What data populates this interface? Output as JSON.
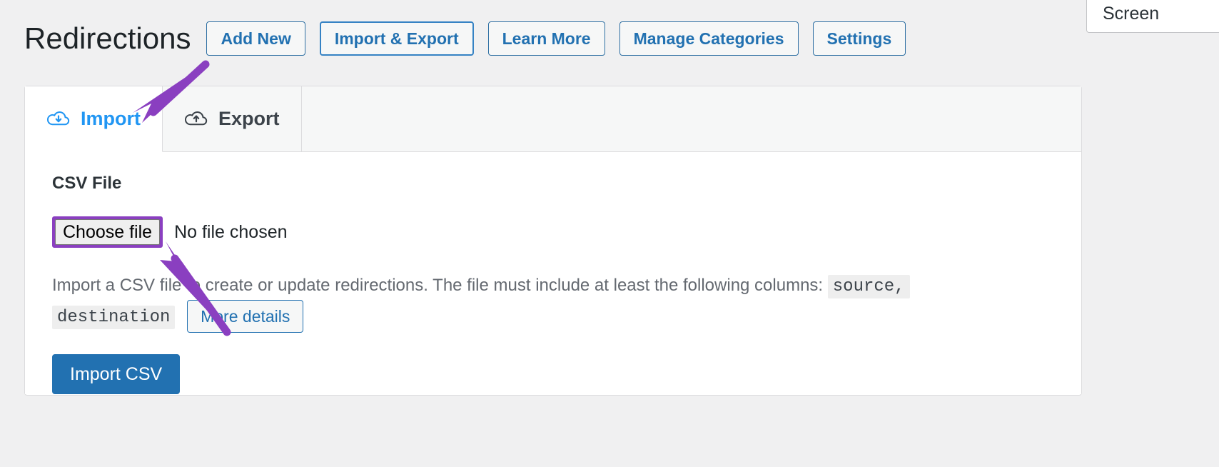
{
  "screen_options": {
    "label": "Screen"
  },
  "header": {
    "title": "Redirections",
    "buttons": [
      {
        "label": "Add New",
        "name": "add-new-button"
      },
      {
        "label": "Import & Export",
        "name": "import-export-button"
      },
      {
        "label": "Learn More",
        "name": "learn-more-button"
      },
      {
        "label": "Manage Categories",
        "name": "manage-categories-button"
      },
      {
        "label": "Settings",
        "name": "settings-button"
      }
    ]
  },
  "tabs": [
    {
      "label": "Import",
      "icon": "cloud-download-icon",
      "active": true
    },
    {
      "label": "Export",
      "icon": "cloud-upload-icon",
      "active": false
    }
  ],
  "import_panel": {
    "field_label": "CSV File",
    "choose_file_label": "Choose file",
    "no_file_text": "No file chosen",
    "description_part1": "Import a CSV file to create or update redirections. The file must include at least the following columns:",
    "code_source": "source,",
    "code_destination": "destination",
    "more_details_label": "More details",
    "submit_label": "Import CSV"
  },
  "colors": {
    "accent_blue": "#2271b1",
    "tab_active_blue": "#2196f3",
    "annotation_purple": "#8a3fc0",
    "page_bg": "#f0f0f1"
  }
}
